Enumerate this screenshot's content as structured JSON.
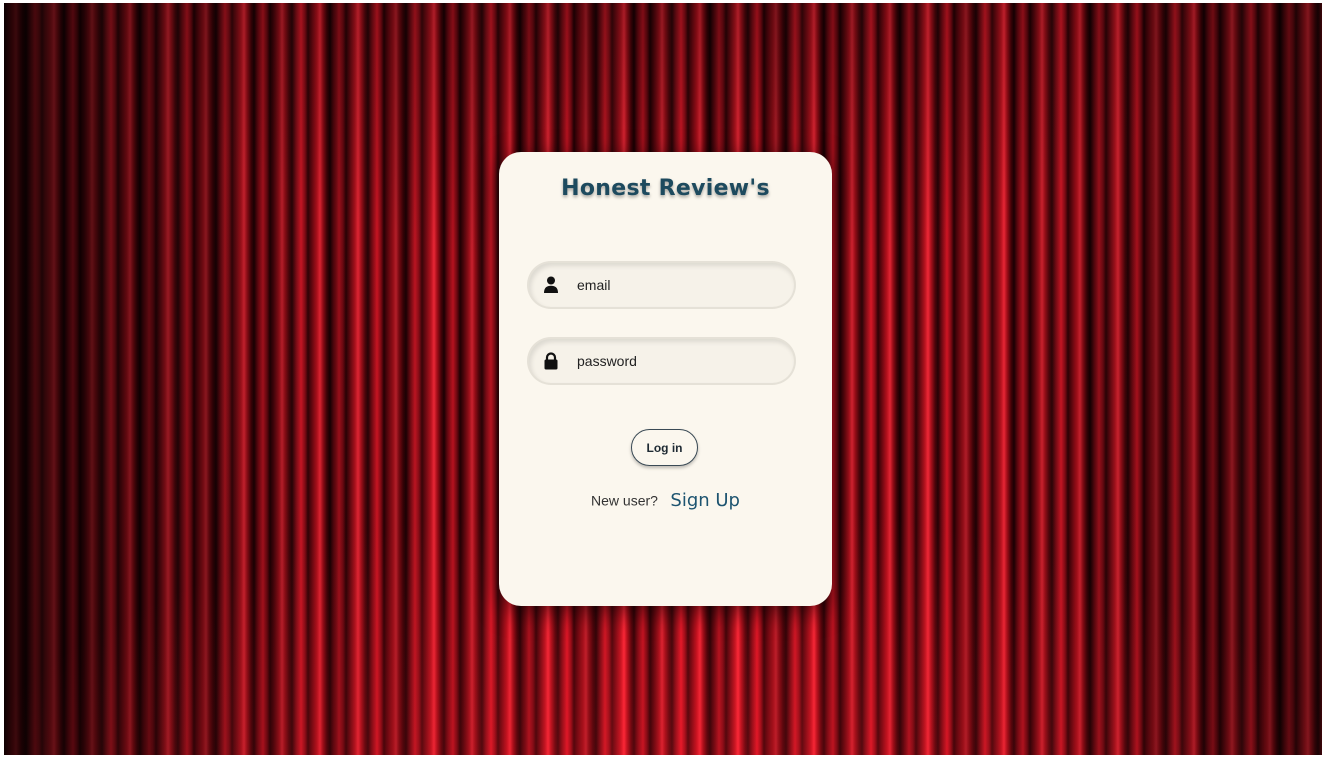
{
  "background": {
    "description_icon": "red-theater-curtain"
  },
  "login_card": {
    "title": "Honest Review's",
    "email_field": {
      "placeholder": "email",
      "value": "",
      "icon": "user-icon"
    },
    "password_field": {
      "placeholder": "password",
      "value": "",
      "icon": "lock-icon"
    },
    "login_button_label": "Log in",
    "new_user_text": "New user?",
    "signup_link_label": "Sign Up"
  },
  "colors": {
    "title": "#1d4a5e",
    "signup_link": "#1d5470",
    "card_background": "#fbf7ee",
    "curtain": "#c4121f"
  }
}
